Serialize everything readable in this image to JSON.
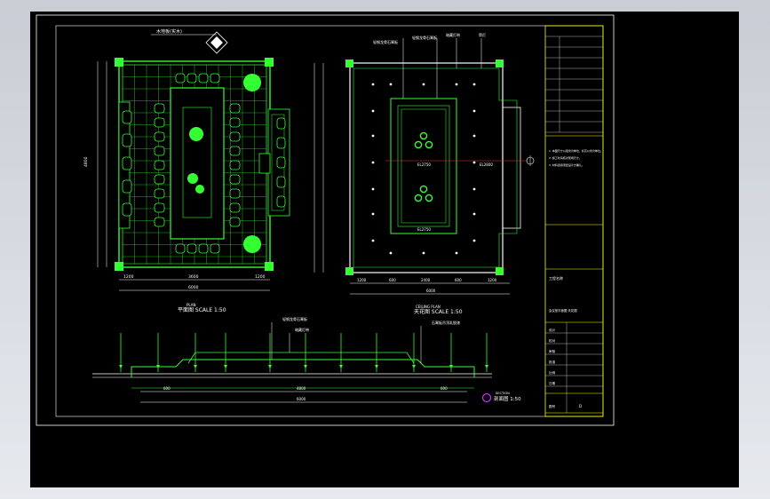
{
  "drawing": {
    "plan_view": {
      "caption": "平面图 SCALE 1:50",
      "caption_en": "PLAN",
      "callout_top": "木地板(实木)",
      "dim_bottom": [
        "1200",
        "3600",
        "1200"
      ],
      "dim_total": "6000",
      "dim_side": "4800"
    },
    "ceiling_view": {
      "caption": "天花图 SCALE 1:50",
      "caption_en": "CEILING PLAN",
      "callouts_top": [
        "轻钢龙骨石膏板",
        "轻钢龙骨石膏板",
        "暗藏灯带",
        "筒灯"
      ],
      "level_labels": [
        "EL2750",
        "EL2800",
        "EL2750"
      ],
      "dim_bottom": [
        "1200",
        "600",
        "2400",
        "600",
        "1200"
      ],
      "dim_total": "6000"
    },
    "section_view": {
      "caption": "剖面图 1:50",
      "caption_en": "SECTION",
      "callouts": [
        "轻钢龙骨石膏板",
        "暗藏灯带",
        "石膏板吊顶乳胶漆"
      ],
      "dim_bottom": [
        "600",
        "4800",
        "600"
      ],
      "dim_total": "6000"
    },
    "title_block": {
      "notes": [
        "1. 本图尺寸以毫米为单位，标高以米为单位。",
        "2. 施工时请核对现场尺寸。",
        "3. 材料选用须经设计方确认。"
      ],
      "project_label": "工程名称",
      "drawing_title": "会议室平面图 天花图",
      "rows": [
        "设计",
        "校对",
        "审核",
        "批准",
        "比例",
        "日期"
      ],
      "drawing_no_label": "图号",
      "drawing_no": "D"
    }
  },
  "colors": {
    "line": "#33ff33",
    "frame": "#ffffff",
    "dim": "#ffffff",
    "titleblock": "#ffff00",
    "accent": "#ff3333",
    "viewport": "#000000"
  }
}
